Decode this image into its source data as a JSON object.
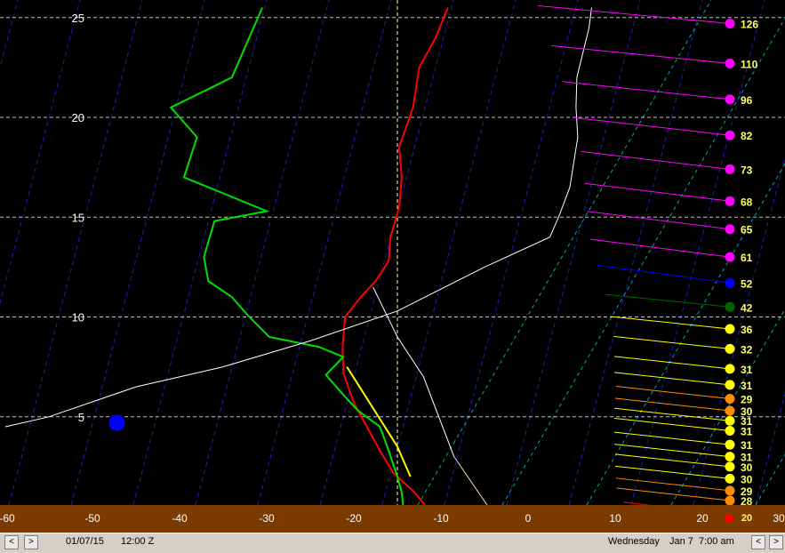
{
  "chart_data": {
    "type": "line",
    "title": "",
    "xlabel": "",
    "ylabel": "",
    "xlim": [
      -60,
      30
    ],
    "ylim": [
      0,
      25.5
    ],
    "x_ticks": [
      "-60",
      "-50",
      "-40",
      "-30",
      "-20",
      "-10",
      "0",
      "10",
      "20",
      "30"
    ],
    "y_ticks": [
      {
        "value": 5,
        "label": "5"
      },
      {
        "value": 10,
        "label": "10"
      },
      {
        "value": 15,
        "label": "15"
      },
      {
        "value": 20,
        "label": "20"
      },
      {
        "value": 25,
        "label": "25"
      }
    ],
    "series": [
      {
        "color": "#ff0000",
        "points": [
          [
            -10.8,
            0
          ],
          [
            -13,
            1.2
          ],
          [
            -15.5,
            2.2
          ],
          [
            -17,
            3.3
          ],
          [
            -18.5,
            4.5
          ],
          [
            -20,
            5.7
          ],
          [
            -21.2,
            7.2
          ],
          [
            -21.3,
            8.5
          ],
          [
            -21,
            10
          ],
          [
            -19.2,
            11
          ],
          [
            -17.5,
            11.8
          ],
          [
            -16,
            12.8
          ],
          [
            -15.8,
            14
          ],
          [
            -14.8,
            15.5
          ],
          [
            -14.5,
            17
          ],
          [
            -14.8,
            18.5
          ],
          [
            -13.2,
            20.5
          ],
          [
            -12.5,
            22.5
          ],
          [
            -10.6,
            24
          ],
          [
            -9.2,
            25.5
          ]
        ]
      },
      {
        "color": "#00e000",
        "points": [
          [
            -14.2,
            0
          ],
          [
            -14.5,
            1.2
          ],
          [
            -15,
            2
          ],
          [
            -16,
            3.3
          ],
          [
            -17,
            4.5
          ],
          [
            -19.5,
            5.3
          ],
          [
            -21,
            6
          ],
          [
            -23.2,
            7.1
          ],
          [
            -21.2,
            8
          ],
          [
            -24,
            8.5
          ],
          [
            -29.7,
            9
          ],
          [
            -32,
            10
          ],
          [
            -34,
            11
          ],
          [
            -36.7,
            11.8
          ],
          [
            -37.2,
            13
          ],
          [
            -36,
            14.8
          ],
          [
            -30,
            15.3
          ],
          [
            -39.5,
            17
          ],
          [
            -38,
            19
          ],
          [
            -41,
            20.5
          ],
          [
            -34,
            22
          ],
          [
            -32,
            24
          ],
          [
            -30.5,
            25.5
          ]
        ]
      },
      {
        "color": "#ffff00",
        "points": [
          [
            -20.8,
            7.5
          ],
          [
            -15,
            3.5
          ],
          [
            -13.5,
            2
          ]
        ]
      },
      {
        "color": "#ffffff",
        "points": [
          [
            -60,
            4.5
          ],
          [
            -55,
            5
          ],
          [
            -45,
            6.5
          ],
          [
            -35,
            7.5
          ],
          [
            -25,
            8.8
          ],
          [
            -15,
            10.3
          ],
          [
            -5,
            12.5
          ],
          [
            2.5,
            14
          ],
          [
            3.5,
            15
          ],
          [
            4.8,
            16.5
          ],
          [
            5.7,
            19
          ],
          [
            5.5,
            20.5
          ],
          [
            5.6,
            22
          ],
          [
            7,
            24.5
          ],
          [
            7.3,
            25.5
          ]
        ]
      },
      {
        "color": "#ffffff",
        "points": [
          [
            -17.8,
            11.5
          ],
          [
            -15,
            9
          ],
          [
            -12,
            7
          ],
          [
            -8.5,
            3
          ]
        ]
      },
      {
        "color": "#ffe0b0",
        "points": [
          [
            -8.5,
            3
          ],
          [
            -3.8,
            0
          ]
        ]
      },
      {
        "color": "#ffffff",
        "points": [
          [
            -60,
            0.2
          ],
          [
            -45,
            0.1
          ]
        ]
      },
      {
        "color": "#ffffff",
        "points": [
          [
            29.5,
            3.9
          ],
          [
            30,
            3.9
          ]
        ]
      }
    ],
    "parcel_marker": {
      "x": -47.2,
      "y": 4.7,
      "color": "#0000ff"
    },
    "dashed_vertical_x": -15,
    "wind_barbs": [
      {
        "speed": "126",
        "y": 24.7,
        "color": "#ff00ff"
      },
      {
        "speed": "110",
        "y": 22.7,
        "color": "#ff00ff"
      },
      {
        "speed": "96",
        "y": 20.9,
        "color": "#ff00ff"
      },
      {
        "speed": "82",
        "y": 19.1,
        "color": "#ff00ff"
      },
      {
        "speed": "73",
        "y": 17.4,
        "color": "#ff00ff"
      },
      {
        "speed": "68",
        "y": 15.8,
        "color": "#ff00ff"
      },
      {
        "speed": "65",
        "y": 14.4,
        "color": "#ff00ff"
      },
      {
        "speed": "61",
        "y": 13,
        "color": "#ff00ff"
      },
      {
        "speed": "52",
        "y": 11.7,
        "color": "#0000ff"
      },
      {
        "speed": "42",
        "y": 10.5,
        "color": "#006400"
      },
      {
        "speed": "36",
        "y": 9.4,
        "color": "#ffff00"
      },
      {
        "speed": "32",
        "y": 8.4,
        "color": "#ffff00"
      },
      {
        "speed": "31",
        "y": 7.4,
        "color": "#ffff00"
      },
      {
        "speed": "31",
        "y": 6.6,
        "color": "#ffff00"
      },
      {
        "speed": "29",
        "y": 5.9,
        "color": "#ff8c00"
      },
      {
        "speed": "30",
        "y": 5.3,
        "color": "#ff8c00"
      },
      {
        "speed": "31",
        "y": 4.8,
        "color": "#ffff00"
      },
      {
        "speed": "31",
        "y": 4.3,
        "color": "#ffff00"
      },
      {
        "speed": "31",
        "y": 3.6,
        "color": "#ffff00"
      },
      {
        "speed": "31",
        "y": 3,
        "color": "#ffff00"
      },
      {
        "speed": "30",
        "y": 2.5,
        "color": "#ffff00"
      },
      {
        "speed": "30",
        "y": 1.9,
        "color": "#ffff00"
      },
      {
        "speed": "29",
        "y": 1.3,
        "color": "#ff8c00"
      },
      {
        "speed": "28",
        "y": 0.8,
        "color": "#ff8c00"
      },
      {
        "speed": "20",
        "y": 0.1,
        "color": "#ff0000"
      }
    ],
    "axis_bar_label": "20",
    "axis_bar_marker_color": "#ff0000",
    "grid": true
  },
  "status": {
    "date": "01/07/15",
    "time_z": "12:00 Z",
    "weekday": "Wednesday",
    "local_date": "Jan 7",
    "local_time": "7:00 am",
    "prev": "<",
    "next": ">"
  },
  "colors": {
    "axis_bar": "#7b3a00",
    "isotherm": "#2020b0",
    "moist_adiabat": "#00c8c8",
    "grid": "#ffffff",
    "wind_label": "#ffff66"
  }
}
